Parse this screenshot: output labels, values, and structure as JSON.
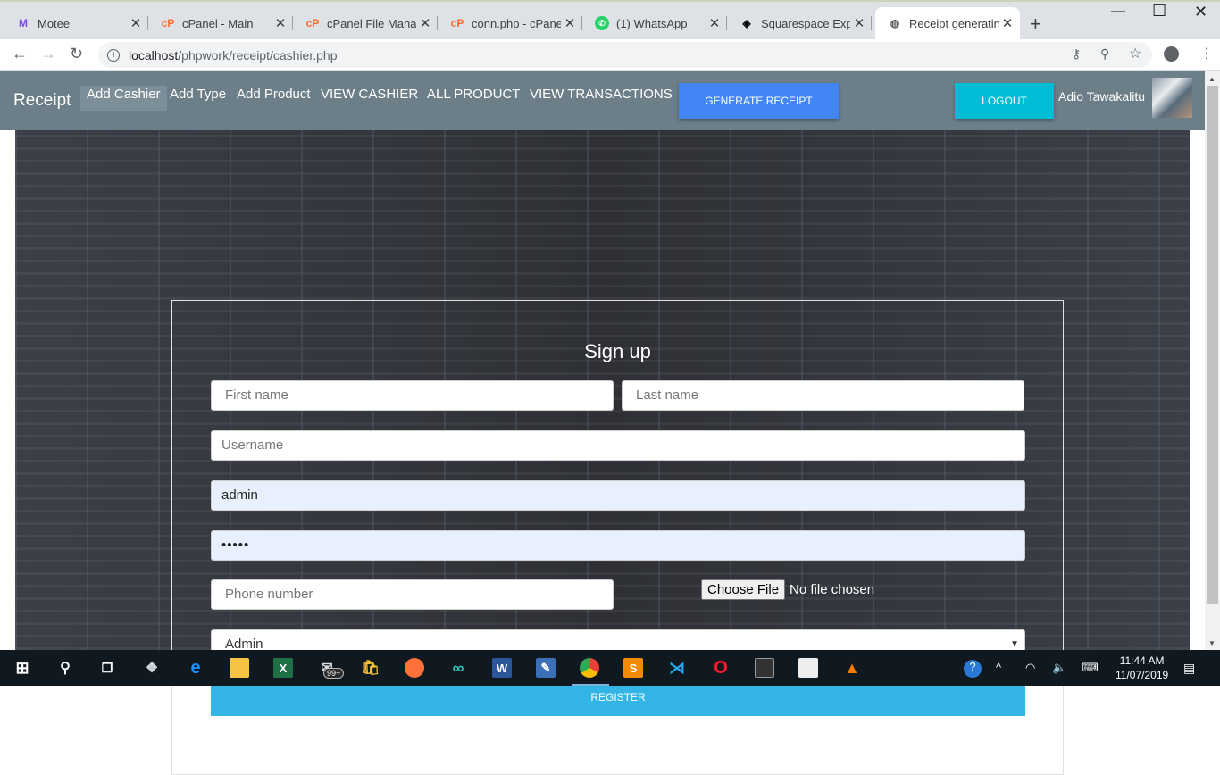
{
  "browser": {
    "tabs": [
      {
        "title": "Motee",
        "icon": "motee-icon",
        "color": "#7a4ee0"
      },
      {
        "title": "cPanel - Main",
        "icon": "cpanel-icon",
        "color": "#ff6c2c"
      },
      {
        "title": "cPanel File Manager",
        "icon": "cpanel-icon",
        "color": "#ff6c2c"
      },
      {
        "title": "conn.php - cPanel",
        "icon": "cpanel-icon",
        "color": "#ff6c2c"
      },
      {
        "title": "(1) WhatsApp",
        "icon": "whatsapp-icon",
        "color": "#25d366"
      },
      {
        "title": "Squarespace Expert",
        "icon": "squarespace-icon",
        "color": "#000000"
      },
      {
        "title": "Receipt generating",
        "icon": "globe-icon",
        "color": "#5f6368",
        "active": true
      }
    ],
    "url_host": "localhost",
    "url_path": "/phpwork/receipt/cashier.php"
  },
  "navbar": {
    "brand": "Receipt",
    "items": [
      {
        "label": "Add Cashier",
        "active": true
      },
      {
        "label": "Add Type"
      },
      {
        "label": "Add Product"
      },
      {
        "label": "VIEW CASHIER"
      },
      {
        "label": "ALL PRODUCT"
      },
      {
        "label": "VIEW TRANSACTIONS"
      }
    ],
    "generate_button": "GENERATE RECEIPT",
    "logout_button": "LOGOUT",
    "user_name": "Adio Tawakalitu"
  },
  "form": {
    "title": "Sign up",
    "first_name_placeholder": "First name",
    "last_name_placeholder": "Last name",
    "username_placeholder": "Username",
    "email_value": "admin",
    "password_value": "•••••",
    "phone_placeholder": "Phone number",
    "file_button": "Choose File",
    "file_status": "No file chosen",
    "role_selected": "Admin",
    "register_button": "REGISTER"
  },
  "taskbar": {
    "time": "11:44 AM",
    "date": "11/07/2019",
    "mail_badge": "99+"
  },
  "colors": {
    "navbar": "#6c7f88",
    "generate": "#4285f4",
    "logout": "#00bcd4",
    "register": "#33b5e5"
  }
}
